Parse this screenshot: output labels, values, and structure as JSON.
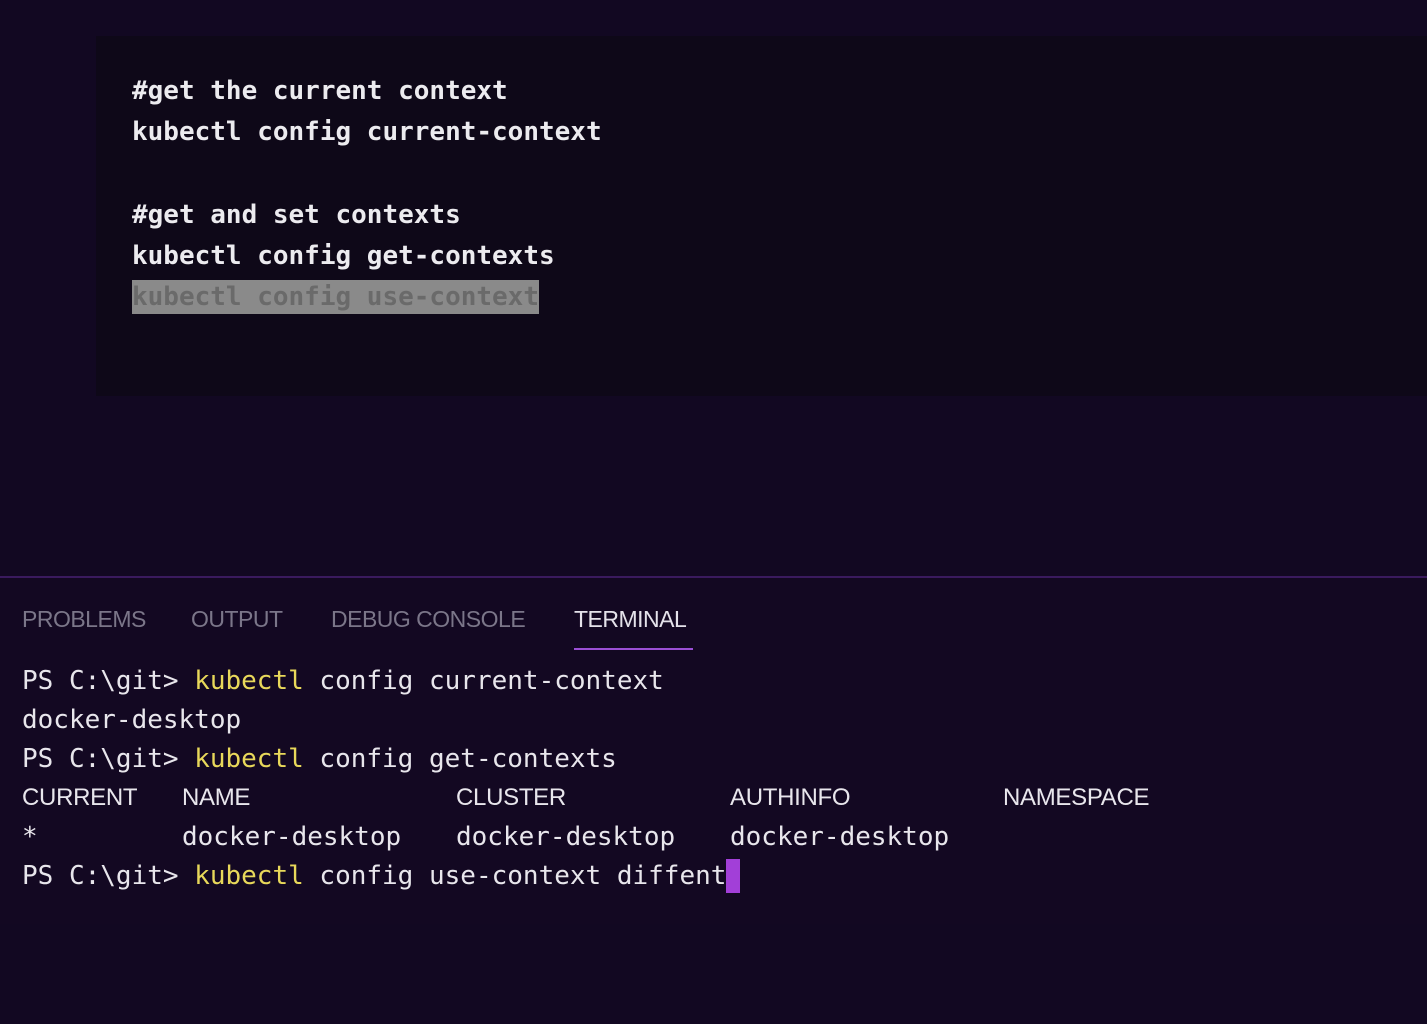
{
  "editor": {
    "lines": [
      "#get the current context",
      "kubectl config current-context",
      "",
      "#get and set contexts",
      "kubectl config get-contexts",
      "kubectl config use-context"
    ]
  },
  "panel": {
    "tabs": [
      "PROBLEMS",
      "OUTPUT",
      "DEBUG CONSOLE",
      "TERMINAL"
    ],
    "active_tab": "TERMINAL"
  },
  "terminal": {
    "prompt": "PS C:\\git> ",
    "cmd1": {
      "kw": "kubectl",
      "rest": " config current-context"
    },
    "out1": "docker-desktop",
    "cmd2": {
      "kw": "kubectl",
      "rest": " config get-contexts"
    },
    "table": {
      "headers": [
        "CURRENT",
        "NAME",
        "CLUSTER",
        "AUTHINFO",
        "NAMESPACE"
      ],
      "row": [
        "*",
        "docker-desktop",
        "docker-desktop",
        "docker-desktop",
        ""
      ]
    },
    "cmd3": {
      "kw": "kubectl",
      "rest": " config use-context diffent"
    }
  },
  "colors": {
    "background": "#120822",
    "keyword": "#e8d85a",
    "accent": "#9b4fd6",
    "cursor": "#a23fd8"
  }
}
